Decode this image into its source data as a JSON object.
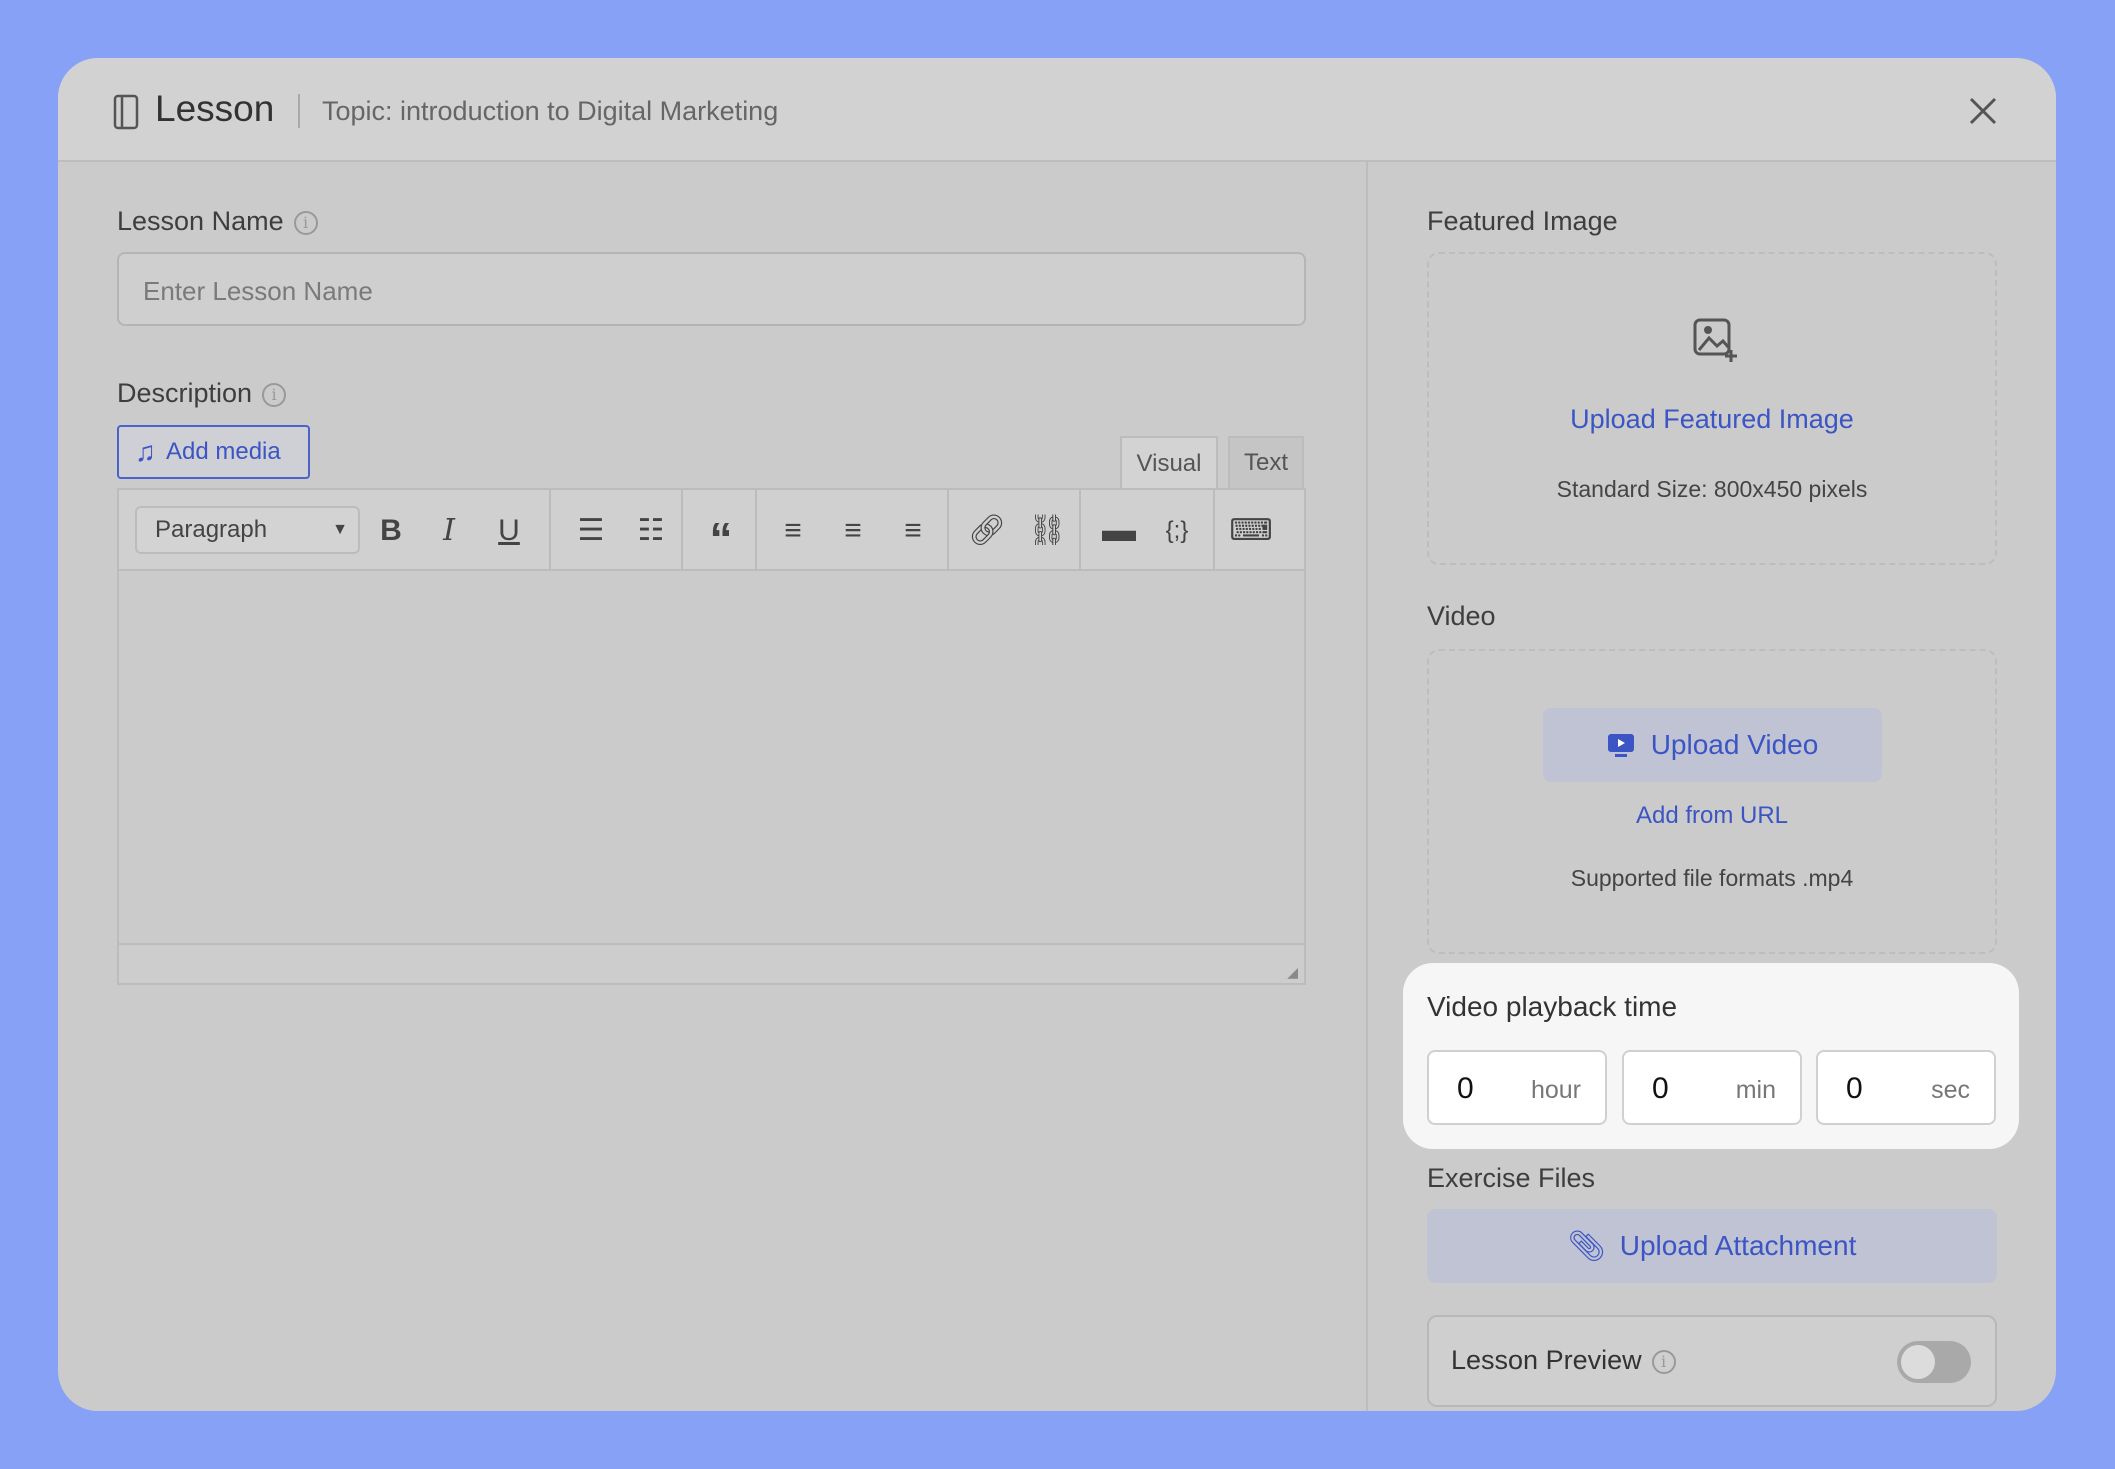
{
  "header": {
    "title": "Lesson",
    "topic": "Topic: introduction to Digital Marketing"
  },
  "lesson_name": {
    "label": "Lesson Name",
    "placeholder": "Enter Lesson Name"
  },
  "description": {
    "label": "Description",
    "add_media": "Add media",
    "tabs": [
      "Visual",
      "Text"
    ],
    "format_select": "Paragraph",
    "toolbar": {
      "bold": "B",
      "italic": "I",
      "underline": "U",
      "blockquote": "“"
    }
  },
  "featured_image": {
    "label": "Featured Image",
    "upload": "Upload Featured Image",
    "hint": "Standard Size: 800x450 pixels"
  },
  "video": {
    "label": "Video",
    "upload": "Upload Video",
    "add_url": "Add from URL",
    "hint": "Supported file formats .mp4"
  },
  "playback": {
    "label": "Video playback time",
    "fields": [
      {
        "value": "0",
        "unit": "hour"
      },
      {
        "value": "0",
        "unit": "min"
      },
      {
        "value": "0",
        "unit": "sec"
      }
    ]
  },
  "exercise": {
    "label": "Exercise Files",
    "upload": "Upload Attachment"
  },
  "preview": {
    "label": "Lesson Preview",
    "enabled": false
  },
  "colors": {
    "background": "#87a1f6",
    "accent": "#3c55c4"
  }
}
